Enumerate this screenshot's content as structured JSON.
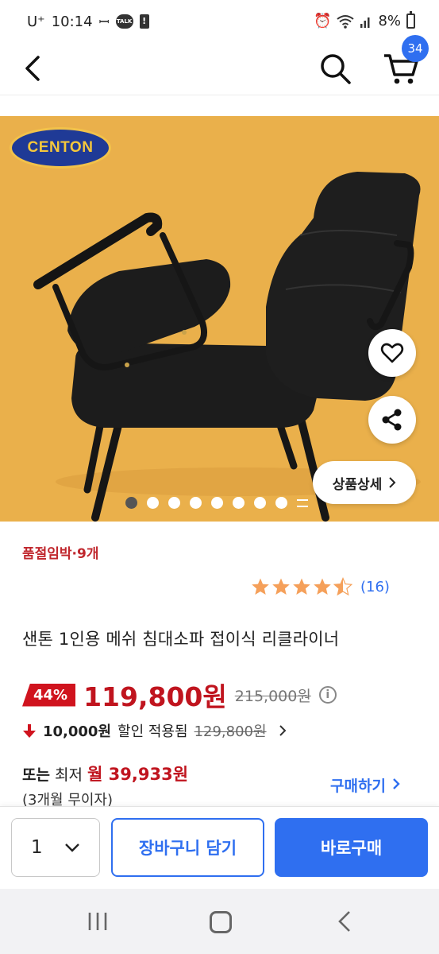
{
  "status_bar": {
    "carrier": "U⁺",
    "time": "10:14",
    "battery": "8%"
  },
  "header": {
    "cart_count": "34"
  },
  "hero": {
    "brand_logo": "CENTON",
    "detail_button": "상품상세",
    "image_count": 8,
    "active_image": 1,
    "bg_color": "#eab04b"
  },
  "product": {
    "stock_notice": "품절임박·9개",
    "rating": 4.5,
    "review_count": "(16)",
    "title": "샌톤 1인용 메쉬 침대소파 접이식 리클라이너",
    "discount": "44%",
    "price": "119,800원",
    "original_price": "215,000원",
    "coupon_amount": "10,000원",
    "coupon_text": "할인 적용됨",
    "coupon_original": "129,800원",
    "installment_prefix": "또는",
    "installment_lowest": "최저",
    "installment_price": "월 39,933원",
    "installment_note": "(3개월 무이자)",
    "buy_link": "구매하기"
  },
  "action_bar": {
    "quantity": "1",
    "cart_button": "장바구니 담기",
    "buy_button": "바로구매",
    "accent": "#2f6ff0"
  },
  "icons": [
    "back-icon",
    "search-icon",
    "cart-icon",
    "heart-icon",
    "share-icon",
    "info-icon",
    "chevron-down-icon",
    "chevron-right-icon",
    "star-icon",
    "arrow-down-icon"
  ]
}
